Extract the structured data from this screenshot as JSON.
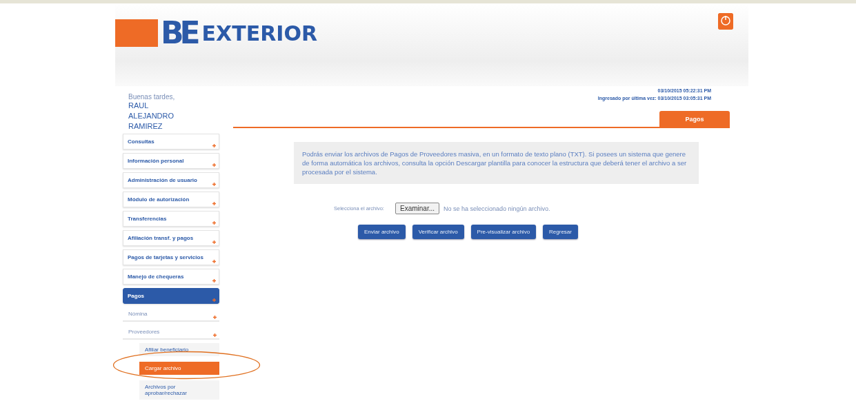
{
  "logo": {
    "mark": "BE",
    "name": "EXTERIOR"
  },
  "greeting": {
    "salutation": "Buenas tardes,",
    "name": [
      "RAUL",
      "ALEJANDRO",
      "RAMIREZ"
    ]
  },
  "session": {
    "current": "03/10/2015 05:22:31 PM",
    "last_login": "Ingresado por última vez: 03/10/2015 03:05:31 PM"
  },
  "tabs": [
    {
      "label": "Pagos",
      "selected": true
    }
  ],
  "sidebar": {
    "items": [
      {
        "label": "Consultas",
        "selected": false
      },
      {
        "label": "Información personal",
        "selected": false
      },
      {
        "label": "Administración de usuario",
        "selected": false
      },
      {
        "label": "Módulo de autorización",
        "selected": false
      },
      {
        "label": "Transferencias",
        "selected": false
      },
      {
        "label": "Afiliación transf. y pagos",
        "selected": false
      },
      {
        "label": "Pagos de tarjetas y servicios",
        "selected": false
      },
      {
        "label": "Manejo de chequeras",
        "selected": false
      },
      {
        "label": "Pagos",
        "selected": true,
        "children": [
          {
            "label": "Nómina",
            "selected": false
          },
          {
            "label": "Proveedores",
            "selected": false,
            "children": [
              {
                "label": "Afiliar beneficiario",
                "selected": false
              },
              {
                "label": "Cargar archivo",
                "selected": true
              },
              {
                "label": "Archivos por aprobar/rechazar",
                "selected": false
              }
            ]
          }
        ]
      }
    ]
  },
  "info": "Podrás enviar los archivos de Pagos de Proveedores masiva, en un formato de texto plano (TXT). Si posees un sistema que genere de forma automática los archivos, consulta la opción Descargar plantilla para conocer la estructura que deberá tener el archivo a ser procesada por el sistema.",
  "file_field": {
    "label": "Selecciona el archivo:",
    "button": "Examinar...",
    "status": "No se ha seleccionado ningún archivo."
  },
  "buttons": [
    "Enviar archivo",
    "Verificar archivo",
    "Pre-visualizar archivo",
    "Regresar"
  ]
}
